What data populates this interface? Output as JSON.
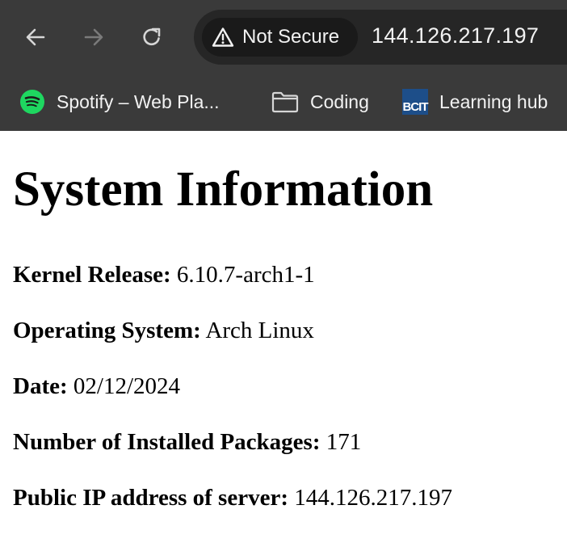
{
  "browser": {
    "security_label": "Not Secure",
    "url": "144.126.217.197",
    "bookmarks": [
      {
        "label": "Spotify – Web Pla...",
        "icon": "spotify-icon"
      },
      {
        "label": "Coding",
        "icon": "folder-icon"
      },
      {
        "label": "Learning hub",
        "icon": "bcit-icon",
        "icon_text": "BCIT"
      }
    ],
    "colors": {
      "chrome_bg": "#3a3a3a",
      "omnibox_bg": "#262626",
      "spotify_green": "#1ed760",
      "bcit_blue": "#1d4e89"
    }
  },
  "page": {
    "title": "System Information",
    "rows": [
      {
        "label": "Kernel Release:",
        "value": "6.10.7-arch1-1"
      },
      {
        "label": "Operating System:",
        "value": "Arch Linux"
      },
      {
        "label": "Date:",
        "value": "02/12/2024"
      },
      {
        "label": "Number of Installed Packages:",
        "value": "171"
      },
      {
        "label": "Public IP address of server:",
        "value": "144.126.217.197"
      }
    ]
  }
}
